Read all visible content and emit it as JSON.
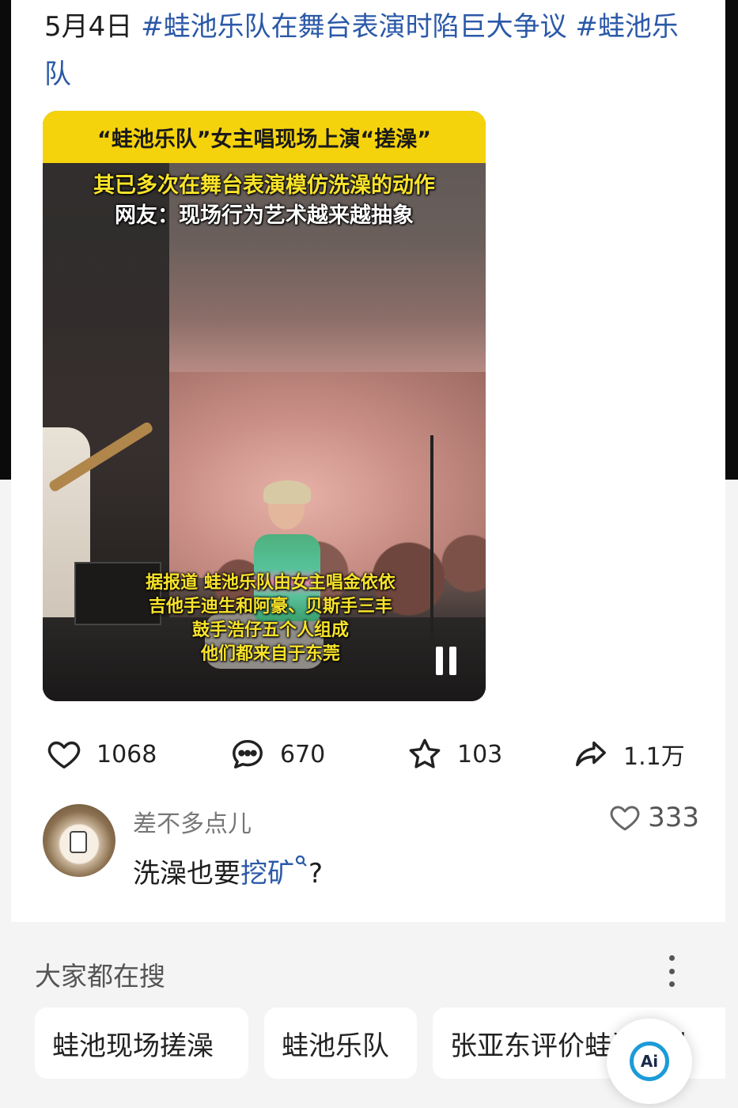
{
  "post": {
    "date": "5月4日",
    "tag1": "#蛙池乐队在舞台表演时陷巨大争议",
    "tag2": "#蛙池乐队"
  },
  "video": {
    "banner": "“蛙池乐队”女主唱现场上演“搓澡”",
    "subtitle_line1": "其已多次在舞台表演模仿洗澡的动作",
    "subtitle_line2": "网友：现场行为艺术越来越抽象",
    "caption_lines": [
      "据报道 蛙池乐队由女主唱金依依",
      "吉他手迪生和阿豪、贝斯手三丰",
      "鼓手浩仔五个人组成",
      "他们都来自于东莞"
    ],
    "state_icon": "pause-icon"
  },
  "stats": {
    "likes": "1068",
    "comments": "670",
    "favorites": "103",
    "shares": "1.1万"
  },
  "comment": {
    "username": "差不多点儿",
    "text_before": "洗澡也要",
    "link_text": "挖矿",
    "link_icon": "search-icon",
    "text_after": "?",
    "likes": "333"
  },
  "hot_search": {
    "title": "大家都在搜",
    "chips": [
      "蛙池现场搓澡",
      "蛙池乐队",
      "张亚东评价蛙池乐队"
    ]
  },
  "ai_button": {
    "label": "Ai"
  },
  "colors": {
    "link": "#2b59a8",
    "banner": "#f5d30c",
    "caption": "#f8e32a",
    "ai_ring": "#1c9bd8"
  }
}
